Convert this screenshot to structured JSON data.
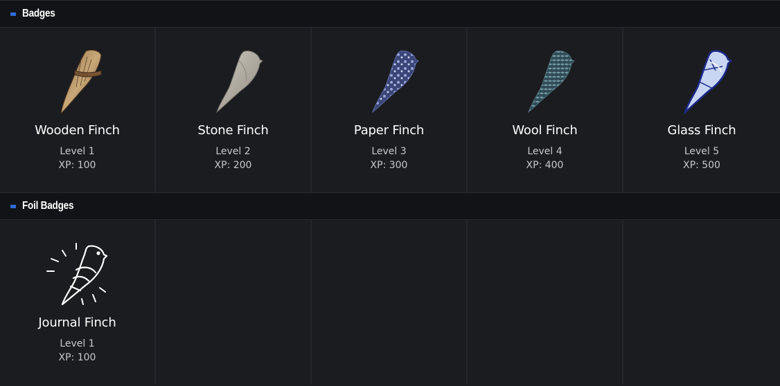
{
  "sections": [
    {
      "title": "Badges",
      "badges": [
        {
          "name": "Wooden Finch",
          "level": "Level 1",
          "xp": "XP: 100",
          "icon": "wooden-finch-icon"
        },
        {
          "name": "Stone Finch",
          "level": "Level 2",
          "xp": "XP: 200",
          "icon": "stone-finch-icon"
        },
        {
          "name": "Paper Finch",
          "level": "Level 3",
          "xp": "XP: 300",
          "icon": "paper-finch-icon"
        },
        {
          "name": "Wool Finch",
          "level": "Level 4",
          "xp": "XP: 400",
          "icon": "wool-finch-icon"
        },
        {
          "name": "Glass Finch",
          "level": "Level 5",
          "xp": "XP: 500",
          "icon": "glass-finch-icon"
        }
      ]
    },
    {
      "title": "Foil Badges",
      "badges": [
        {
          "name": "Journal Finch",
          "level": "Level 1",
          "xp": "XP: 100",
          "icon": "journal-finch-icon"
        }
      ]
    }
  ],
  "colors": {
    "background": "#1b1c20",
    "header_background": "#121316",
    "accent": "#2e6bd6"
  }
}
